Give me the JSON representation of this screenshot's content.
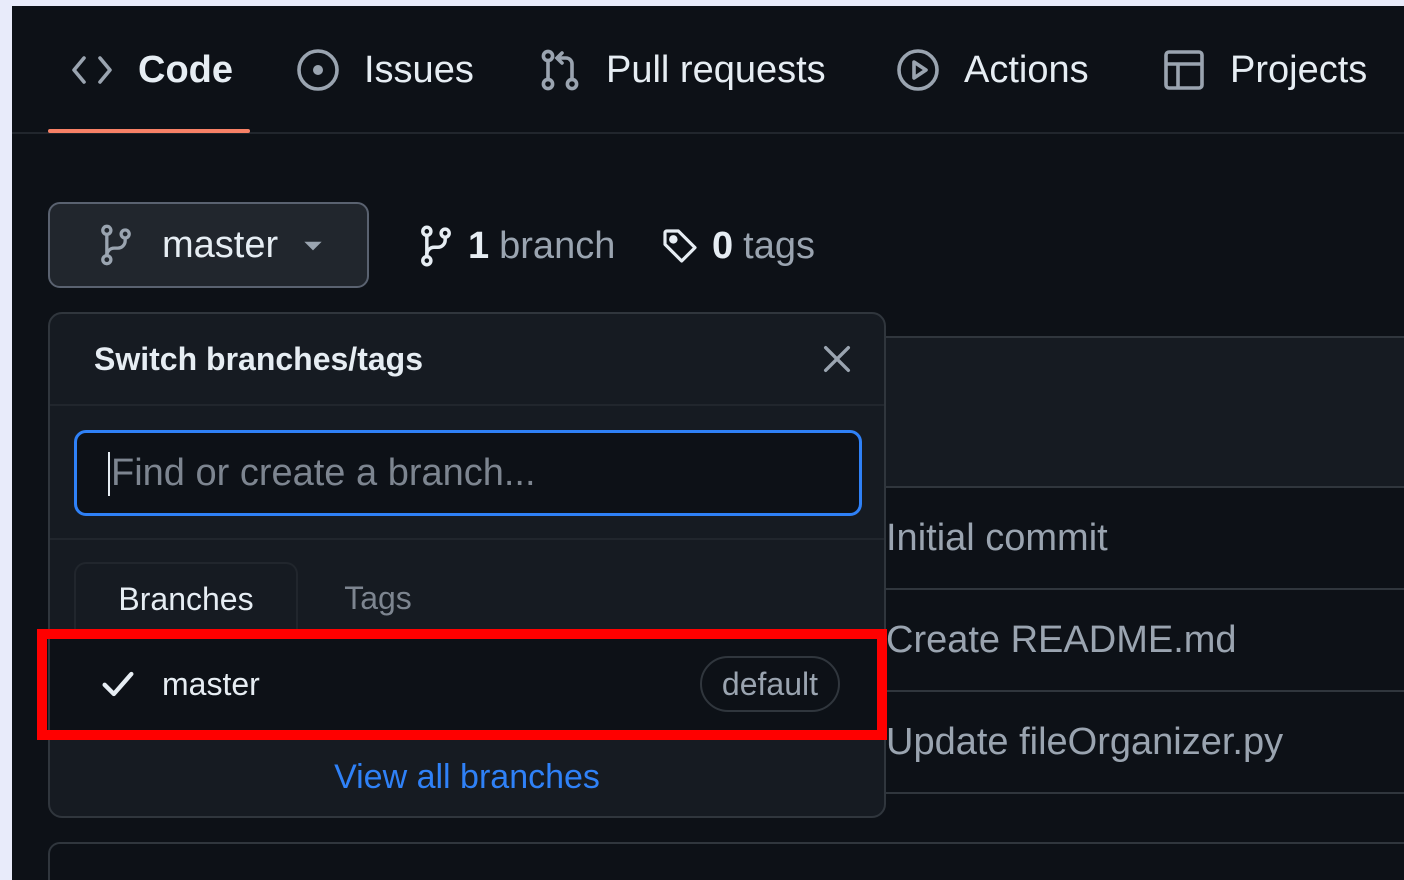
{
  "tabs": [
    {
      "label": "Code",
      "icon": "code-icon",
      "selected": true
    },
    {
      "label": "Issues",
      "icon": "issue-opened-icon",
      "selected": false
    },
    {
      "label": "Pull requests",
      "icon": "pull-request-icon",
      "selected": false
    },
    {
      "label": "Actions",
      "icon": "play-icon",
      "selected": false
    },
    {
      "label": "Projects",
      "icon": "table-icon",
      "selected": false
    }
  ],
  "branch_button": {
    "label": "master"
  },
  "branch_count": {
    "number": "1",
    "label": "branch"
  },
  "tag_count": {
    "number": "0",
    "label": "tags"
  },
  "dropdown": {
    "title": "Switch branches/tags",
    "search_placeholder": "Find or create a branch...",
    "tabs": {
      "branches": "Branches",
      "tags": "Tags"
    },
    "items": [
      {
        "label": "master",
        "badge": "default",
        "selected": true
      }
    ],
    "footer_link": "View all branches"
  },
  "commits": [
    {
      "message": "Initial commit"
    },
    {
      "message": "Create README.md"
    },
    {
      "message": "Update fileOrganizer.py"
    }
  ],
  "colors": {
    "background": "#0d1117",
    "accent_underline": "#f78166",
    "link": "#2f81f7",
    "highlight": "#ff0000"
  }
}
